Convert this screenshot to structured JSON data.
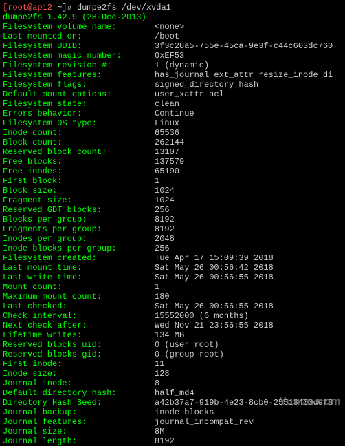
{
  "prompt": {
    "user_host": "[root@api2",
    "sep": " ~]# ",
    "command": "dumpe2fs /dev/xvda1"
  },
  "header": "dumpe2fs 1.42.9 (28-Dec-2013)",
  "rows": [
    {
      "label": "Filesystem volume name:",
      "value": "<none>"
    },
    {
      "label": "Last mounted on:",
      "value": "/boot"
    },
    {
      "label": "Filesystem UUID:",
      "value": "3f3c28a5-755e-45ca-9e3f-c44c603dc760"
    },
    {
      "label": "Filesystem magic number:",
      "value": "0xEF53"
    },
    {
      "label": "Filesystem revision #:",
      "value": "1 (dynamic)"
    },
    {
      "label": "Filesystem features:",
      "value": "has_journal ext_attr resize_inode di"
    },
    {
      "label": "Filesystem flags:",
      "value": "signed_directory_hash"
    },
    {
      "label": "Default mount options:",
      "value": "user_xattr acl"
    },
    {
      "label": "Filesystem state:",
      "value": "clean"
    },
    {
      "label": "Errors behavior:",
      "value": "Continue"
    },
    {
      "label": "Filesystem OS type:",
      "value": "Linux"
    },
    {
      "label": "Inode count:",
      "value": "65536"
    },
    {
      "label": "Block count:",
      "value": "262144"
    },
    {
      "label": "Reserved block count:",
      "value": "13107"
    },
    {
      "label": "Free blocks:",
      "value": "137579"
    },
    {
      "label": "Free inodes:",
      "value": "65190"
    },
    {
      "label": "First block:",
      "value": "1"
    },
    {
      "label": "Block size:",
      "value": "1024"
    },
    {
      "label": "Fragment size:",
      "value": "1024"
    },
    {
      "label": "Reserved GDT blocks:",
      "value": "256"
    },
    {
      "label": "Blocks per group:",
      "value": "8192"
    },
    {
      "label": "Fragments per group:",
      "value": "8192"
    },
    {
      "label": "Inodes per group:",
      "value": "2048"
    },
    {
      "label": "Inode blocks per group:",
      "value": "256"
    },
    {
      "label": "Filesystem created:",
      "value": "Tue Apr 17 15:09:39 2018"
    },
    {
      "label": "Last mount time:",
      "value": "Sat May 26 00:56:42 2018"
    },
    {
      "label": "Last write time:",
      "value": "Sat May 26 00:56:55 2018"
    },
    {
      "label": "Mount count:",
      "value": "1"
    },
    {
      "label": "Maximum mount count:",
      "value": "180"
    },
    {
      "label": "Last checked:",
      "value": "Sat May 26 00:56:55 2018"
    },
    {
      "label": "Check interval:",
      "value": "15552000 (6 months)"
    },
    {
      "label": "Next check after:",
      "value": "Wed Nov 21 23:56:55 2018"
    },
    {
      "label": "Lifetime writes:",
      "value": "134 MB"
    },
    {
      "label": "Reserved blocks uid:",
      "value": "0 (user root)"
    },
    {
      "label": "Reserved blocks gid:",
      "value": "0 (group root)"
    },
    {
      "label": "First inode:",
      "value": "11"
    },
    {
      "label": "Inode size:",
      "value": "128"
    },
    {
      "label": "Journal inode:",
      "value": "8"
    },
    {
      "label": "Default directory hash:",
      "value": "half_md4"
    },
    {
      "label": "Directory Hash Seed:",
      "value": "a42b37a7-919b-4e23-8cb0-25513400def3"
    },
    {
      "label": "Journal backup:",
      "value": "inode blocks"
    },
    {
      "label": "Journal features:",
      "value": "journal_incompat_rev"
    },
    {
      "label": "Journal size:",
      "value": "8M"
    },
    {
      "label": "Journal length:",
      "value": "8192"
    }
  ],
  "watermark": "Yuucn.com"
}
